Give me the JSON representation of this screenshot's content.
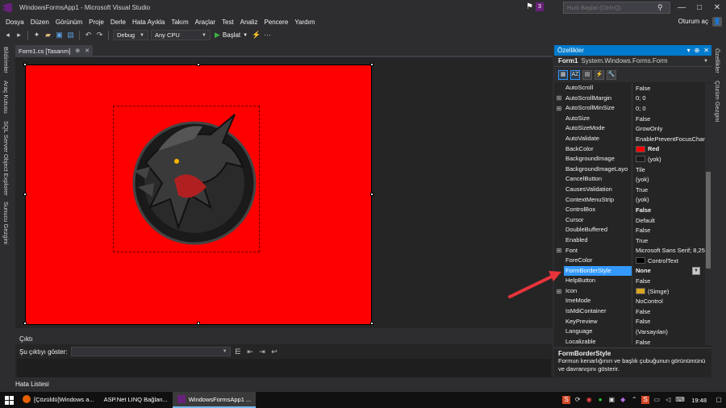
{
  "window": {
    "title": "WindowsFormsApp1 - Microsoft Visual Studio",
    "notification_count": "3",
    "quick_launch_placeholder": "Hızlı Başlat (Ctrl+Q)",
    "user_name": "Oturum aç"
  },
  "menu": [
    "Dosya",
    "Düzen",
    "Görünüm",
    "Proje",
    "Derle",
    "Hata Ayıkla",
    "Takım",
    "Araçlar",
    "Test",
    "Analiz",
    "Pencere",
    "Yardım"
  ],
  "toolbar": {
    "config": "Debug",
    "platform": "Any CPU",
    "start_label": "Başlat"
  },
  "left_tabs": [
    "Bildirimler",
    "Araç Kutusu",
    "SQL Server Object Explorer",
    "Sunucu Gezgini"
  ],
  "right_tabs": [
    "Özellikler",
    "Çözüm Gezgini"
  ],
  "document": {
    "tab_label": "Form1.cs [Tasarım]",
    "form_backcolor": "#ff0000"
  },
  "output": {
    "title": "Çıktı",
    "show_from_label": "Şu çıktıyı göster:"
  },
  "bottom_tab": "Hata Listesi",
  "properties": {
    "title": "Özellikler",
    "object_name": "Form1",
    "object_type": "System.Windows.Forms.Form",
    "rows": [
      {
        "name": "AutoScroll",
        "value": "False",
        "expand": ""
      },
      {
        "name": "AutoScrollMargin",
        "value": "0; 0",
        "expand": "⊞"
      },
      {
        "name": "AutoScrollMinSize",
        "value": "0; 0",
        "expand": "⊞"
      },
      {
        "name": "AutoSize",
        "value": "False",
        "expand": ""
      },
      {
        "name": "AutoSizeMode",
        "value": "GrowOnly",
        "expand": ""
      },
      {
        "name": "AutoValidate",
        "value": "EnablePreventFocusChan",
        "expand": ""
      },
      {
        "name": "BackColor",
        "value": "Red",
        "expand": "",
        "swatch": "#ff0000",
        "bold": true
      },
      {
        "name": "BackgroundImage",
        "value": "(yok)",
        "expand": "",
        "swatch": "#1a1a1a"
      },
      {
        "name": "BackgroundImageLayo",
        "value": "Tile",
        "expand": ""
      },
      {
        "name": "CancelButton",
        "value": "(yok)",
        "expand": ""
      },
      {
        "name": "CausesValidation",
        "value": "True",
        "expand": ""
      },
      {
        "name": "ContextMenuStrip",
        "value": "(yok)",
        "expand": ""
      },
      {
        "name": "ControlBox",
        "value": "False",
        "expand": "",
        "bold": true
      },
      {
        "name": "Cursor",
        "value": "Default",
        "expand": ""
      },
      {
        "name": "DoubleBuffered",
        "value": "False",
        "expand": ""
      },
      {
        "name": "Enabled",
        "value": "True",
        "expand": ""
      },
      {
        "name": "Font",
        "value": "Microsoft Sans Serif; 8,25",
        "expand": "⊞"
      },
      {
        "name": "ForeColor",
        "value": "ControlText",
        "expand": "",
        "swatch": "#000000"
      },
      {
        "name": "FormBorderStyle",
        "value": "None",
        "expand": "",
        "bold": true,
        "selected": true
      },
      {
        "name": "HelpButton",
        "value": "False",
        "expand": ""
      },
      {
        "name": "Icon",
        "value": "(Simge)",
        "expand": "⊞",
        "swatch": "#d9a520"
      },
      {
        "name": "ImeMode",
        "value": "NoControl",
        "expand": ""
      },
      {
        "name": "IsMdiContainer",
        "value": "False",
        "expand": ""
      },
      {
        "name": "KeyPreview",
        "value": "False",
        "expand": ""
      },
      {
        "name": "Language",
        "value": "(Varsayılan)",
        "expand": ""
      },
      {
        "name": "Localizable",
        "value": "False",
        "expand": ""
      }
    ],
    "desc_title": "FormBorderStyle",
    "desc_text": "Formun kenarlığının ve başlık çubuğunun görünümünü ve davranışını gösterir."
  },
  "taskbar": {
    "items": [
      "[Çözüldü]Windows a...",
      "ASP.Net LINQ Bağlan...",
      "WindowsFormsApp1 ..."
    ],
    "clock": "19:48"
  }
}
